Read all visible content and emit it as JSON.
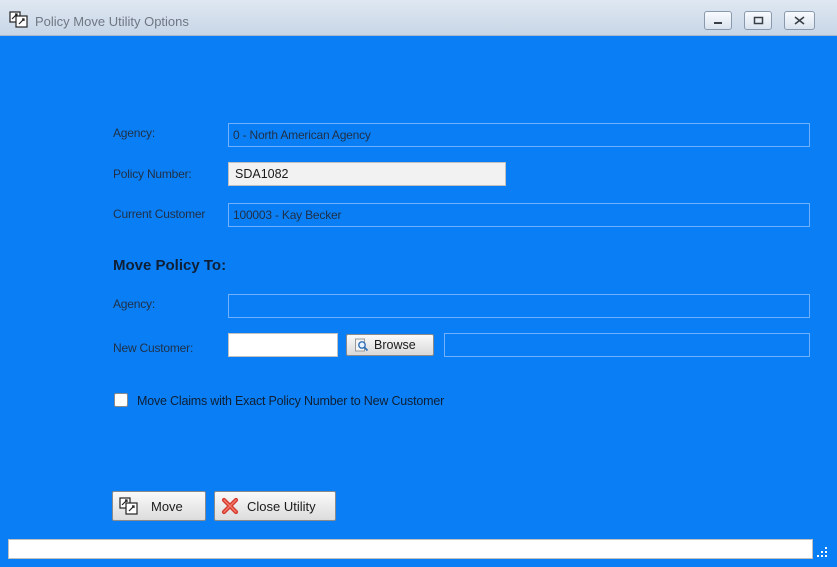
{
  "window": {
    "title": "Policy Move Utility Options"
  },
  "current": {
    "agency_label": "Agency:",
    "agency_value": "0 - North American Agency",
    "policy_label": "Policy Number:",
    "policy_value": "SDA1082",
    "customer_label": "Current Customer",
    "customer_value": "100003 - Kay Becker"
  },
  "move_to": {
    "heading": "Move Policy To:",
    "agency_label": "Agency:",
    "agency_value": "",
    "new_customer_label": "New Customer:",
    "new_customer_value": "",
    "browse_label": "Browse",
    "customer_name_value": ""
  },
  "options": {
    "move_claims_label": "Move Claims with Exact Policy Number to New Customer",
    "move_claims_checked": false
  },
  "buttons": {
    "move_label": "Move",
    "close_label": "Close Utility"
  },
  "status": {
    "text": ""
  }
}
